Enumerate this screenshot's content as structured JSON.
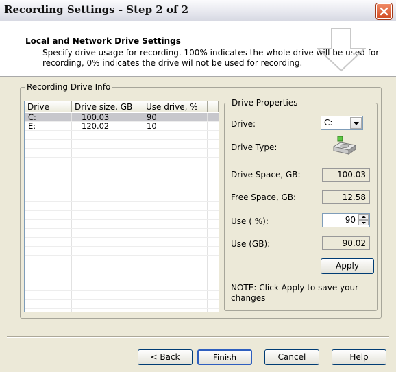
{
  "window": {
    "title": "Recording Settings - Step 2 of 2"
  },
  "header": {
    "title": "Local and Network Drive Settings",
    "description": "Specify drive usage for recording. 100% indicates the whole drive will be used for recording, 0% indicates the drive wil not be used for recording."
  },
  "recording_drive_info": {
    "label": "Recording Drive Info",
    "columns": [
      "Drive",
      "Drive size, GB",
      "Use drive, %"
    ],
    "rows": [
      {
        "drive": "C:",
        "size": "100.03",
        "use": "90",
        "selected": true
      },
      {
        "drive": "E:",
        "size": "120.02",
        "use": "10",
        "selected": false
      }
    ]
  },
  "drive_properties": {
    "label": "Drive Properties",
    "drive_label": "Drive:",
    "drive_value": "C:",
    "drive_type_label": "Drive Type:",
    "drive_space_label": "Drive Space, GB:",
    "drive_space_value": "100.03",
    "free_space_label": "Free Space, GB:",
    "free_space_value": "12.58",
    "use_pct_label": "Use ( %):",
    "use_pct_value": "90",
    "use_gb_label": "Use (GB):",
    "use_gb_value": "90.02",
    "apply_label": "Apply",
    "note": "NOTE: Click Apply to save your changes"
  },
  "footer": {
    "back": "< Back",
    "finish": "Finish",
    "cancel": "Cancel",
    "help": "Help"
  }
}
